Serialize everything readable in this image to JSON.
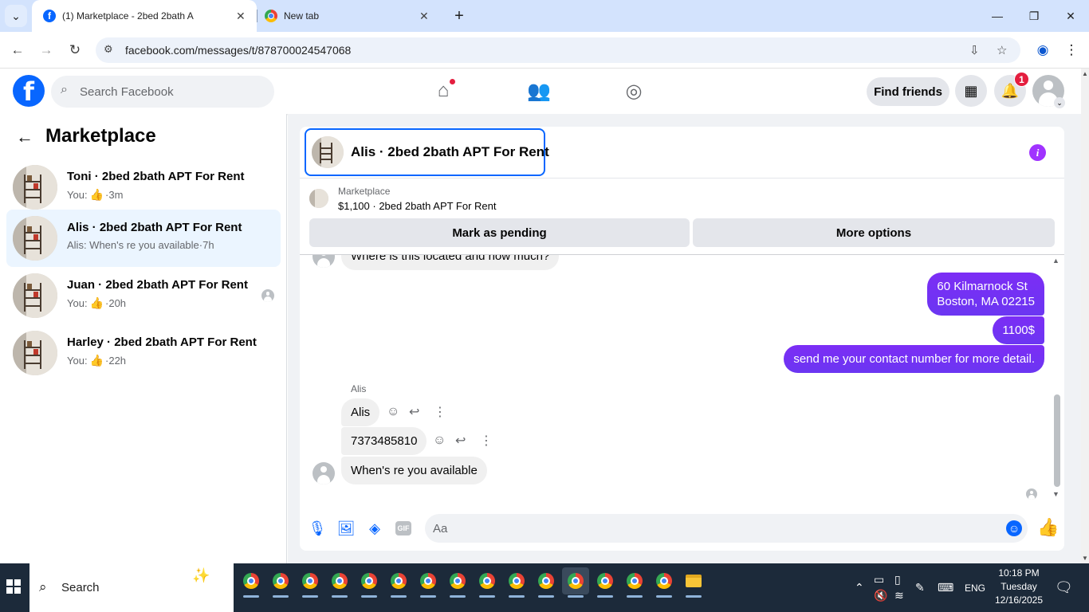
{
  "browser": {
    "tabs": [
      {
        "title": "(1) Marketplace - 2bed 2bath A",
        "icon": "facebook-icon",
        "active": true
      },
      {
        "title": "New tab",
        "icon": "chrome-icon",
        "active": false
      }
    ],
    "url": "facebook.com/messages/t/878700024547068"
  },
  "fb": {
    "search_placeholder": "Search Facebook",
    "find_friends": "Find friends",
    "notification_count": "1"
  },
  "sidebar": {
    "title": "Marketplace",
    "conversations": [
      {
        "name": "Toni · 2bed 2bath APT For Rent",
        "prefix": "You:",
        "time": "3m",
        "liked": true,
        "active": false
      },
      {
        "name": "Alis · 2bed 2bath APT For Rent",
        "prefix": "Alis: When's re you available",
        "time": "7h",
        "liked": false,
        "active": true
      },
      {
        "name": "Juan · 2bed 2bath APT For Rent",
        "prefix": "You:",
        "time": "20h",
        "liked": true,
        "active": false
      },
      {
        "name": "Harley · 2bed 2bath APT For Rent",
        "prefix": "You:",
        "time": "22h",
        "liked": true,
        "active": false
      }
    ]
  },
  "chat": {
    "title": "Alis · 2bed 2bath APT For Rent",
    "marketplace_label": "Marketplace",
    "listing": "$1,100 · 2bed 2bath APT For Rent",
    "mark_pending": "Mark as pending",
    "more_options": "More options",
    "partial_message": "Where is this located and how much?",
    "outgoing": [
      "60 Kilmarnock St",
      "Boston, MA 02215",
      "1100$",
      "send me your contact number for more detail."
    ],
    "sender_name": "Alis",
    "incoming": [
      "Alis",
      "7373485810",
      "When's re you available"
    ],
    "composer_placeholder": "Aa"
  },
  "taskbar": {
    "search_label": "Search",
    "language": "ENG",
    "time": "10:18 PM",
    "day": "Tuesday",
    "date": "12/16/2025"
  },
  "colors": {
    "facebook_blue": "#0866ff",
    "messenger_purple": "#7d2df6",
    "notification_red": "#e41e3f"
  }
}
